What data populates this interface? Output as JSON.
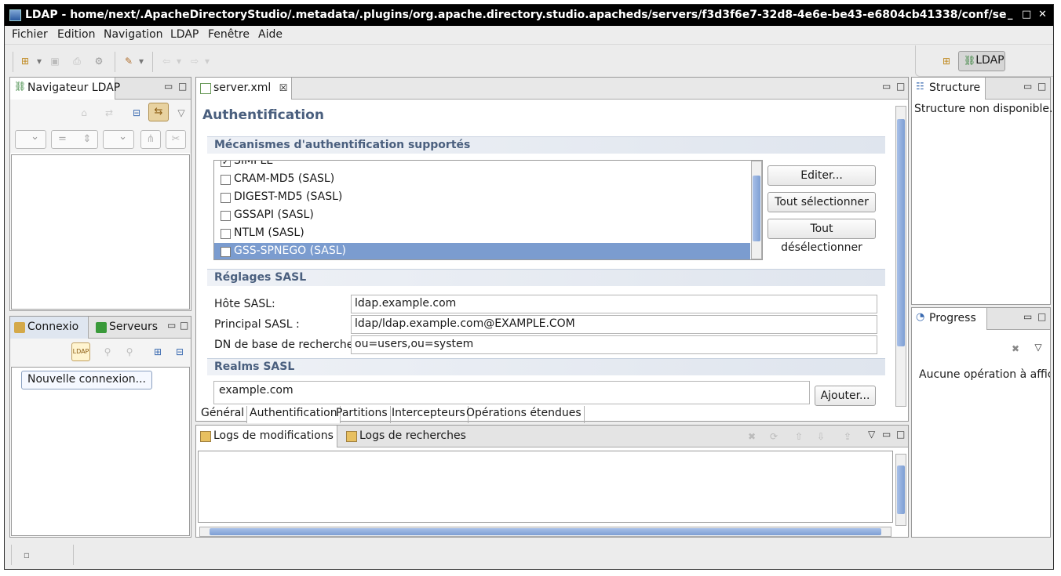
{
  "window": {
    "title": "LDAP - home/next/.ApacheDirectoryStudio/.metadata/.plugins/org.apache.directory.studio.apacheds/servers/f3d3f6e7-32d8-4e6e-be43-e6804cb41338/conf/server."
  },
  "menu": [
    "Fichier",
    "Edition",
    "Navigation",
    "LDAP",
    "Fenêtre",
    "Aide"
  ],
  "perspective": {
    "label": "LDAP"
  },
  "navigator": {
    "tab_label": "Navigateur LDAP"
  },
  "connections": {
    "tab_connexions": "Connexio",
    "tab_servers": "Serveurs",
    "new_connection_tooltip": "Nouvelle connexion..."
  },
  "editor": {
    "tab_label": "server.xml",
    "heading": "Authentification",
    "mechanisms": {
      "title": "Mécanismes d'authentification supportés",
      "items": [
        {
          "label": "SIMPLE",
          "checked": true,
          "selected": false
        },
        {
          "label": "CRAM-MD5 (SASL)",
          "checked": false,
          "selected": false
        },
        {
          "label": "DIGEST-MD5 (SASL)",
          "checked": false,
          "selected": false
        },
        {
          "label": "GSSAPI (SASL)",
          "checked": false,
          "selected": false
        },
        {
          "label": "NTLM (SASL)",
          "checked": false,
          "selected": false
        },
        {
          "label": "GSS-SPNEGO (SASL)",
          "checked": false,
          "selected": true
        }
      ],
      "edit_button": "Editer...",
      "select_all_button": "Tout sélectionner",
      "deselect_all_button": "Tout désélectionner"
    },
    "sasl": {
      "title": "Réglages SASL",
      "host_label": "Hôte SASL:",
      "host_value": "ldap.example.com",
      "principal_label": "Principal SASL :",
      "principal_value": "ldap/ldap.example.com@EXAMPLE.COM",
      "basedn_label": "DN de base de recherche:",
      "basedn_value": "ou=users,ou=system"
    },
    "realms": {
      "title": "Realms SASL",
      "items": [
        "example.com"
      ],
      "add_button": "Ajouter..."
    },
    "bottom_tabs": [
      "Général",
      "Authentification",
      "Partitions",
      "Intercepteurs",
      "Opérations étendues"
    ]
  },
  "structure": {
    "tab_label": "Structure",
    "message": "Structure non disponible."
  },
  "progress": {
    "tab_label": "Progress",
    "message": "Aucune opération à affich"
  },
  "logs": {
    "tab_modifications": "Logs de modifications",
    "tab_searches": "Logs de recherches"
  },
  "colors": {
    "selection": "#7b9ccf",
    "section_title": "#4a5f7e",
    "titlebar": "#000000"
  }
}
